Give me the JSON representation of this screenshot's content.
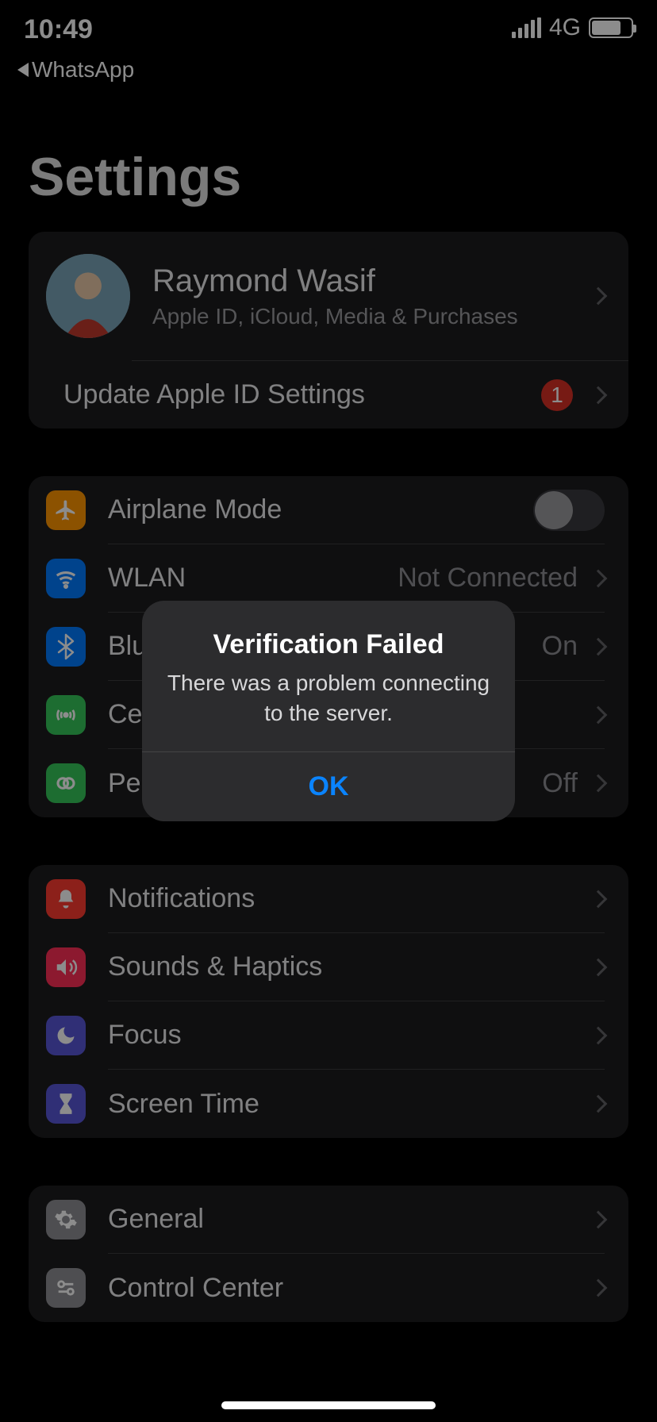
{
  "status": {
    "time": "10:49",
    "network": "4G",
    "back_app": "WhatsApp"
  },
  "page": {
    "title": "Settings"
  },
  "profile": {
    "name": "Raymond Wasif",
    "subtitle": "Apple ID, iCloud, Media & Purchases",
    "update_label": "Update Apple ID Settings",
    "update_badge": "1"
  },
  "connectivity": {
    "airplane": "Airplane Mode",
    "wlan": {
      "label": "WLAN",
      "value": "Not Connected"
    },
    "bluetooth": {
      "label": "Bluetooth",
      "value": "On"
    },
    "cellular": "Cellular",
    "hotspot": {
      "label": "Personal Hotspot",
      "value": "Off"
    }
  },
  "system": {
    "notifications": "Notifications",
    "sounds": "Sounds & Haptics",
    "focus": "Focus",
    "screentime": "Screen Time"
  },
  "general_section": {
    "general": "General",
    "control_center": "Control Center"
  },
  "alert": {
    "title": "Verification Failed",
    "message": "There was a problem connecting to the server.",
    "ok": "OK"
  },
  "colors": {
    "orange": "#ff9500",
    "blue": "#007aff",
    "green": "#34c759",
    "red": "#ff3b30",
    "pink": "#ff2d55",
    "indigo": "#5856d6",
    "gray": "#8e8e93"
  }
}
